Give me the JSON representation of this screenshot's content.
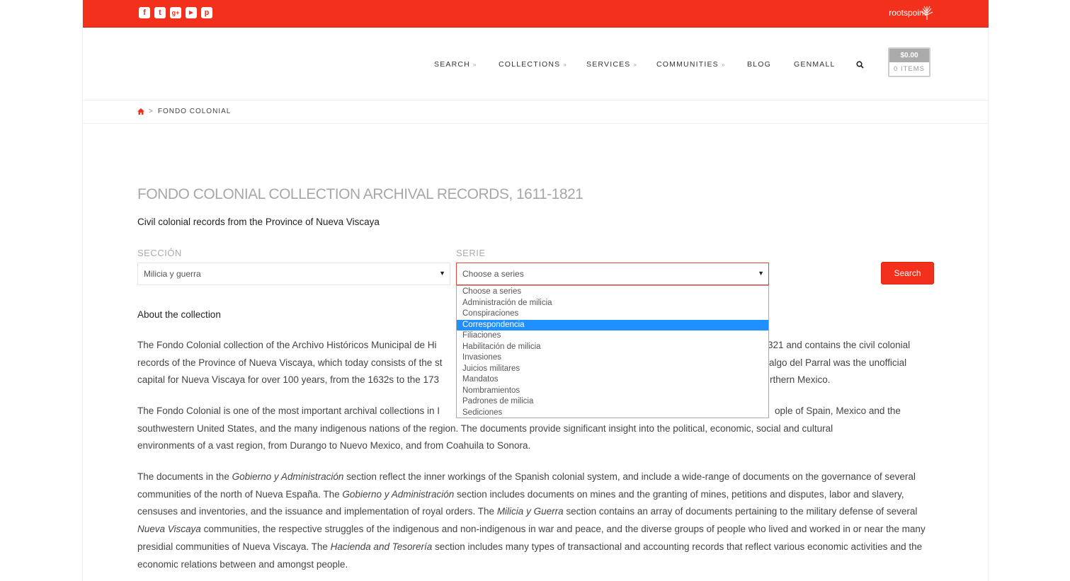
{
  "topbar": {
    "social_icons": [
      {
        "name": "facebook-icon",
        "glyph": "f"
      },
      {
        "name": "twitter-icon",
        "glyph": "t"
      },
      {
        "name": "google-plus-icon",
        "glyph": "g+"
      },
      {
        "name": "youtube-icon",
        "glyph": "▶"
      },
      {
        "name": "pinterest-icon",
        "glyph": "p"
      }
    ],
    "brand": "rootspoint",
    "color": "#f2301b"
  },
  "nav": {
    "items": [
      {
        "label": "SEARCH",
        "dropdown": true
      },
      {
        "label": "COLLECTIONS",
        "dropdown": true
      },
      {
        "label": "SERVICES",
        "dropdown": true
      },
      {
        "label": "COMMUNITIES",
        "dropdown": true
      },
      {
        "label": "BLOG",
        "dropdown": false
      },
      {
        "label": "GENMALL",
        "dropdown": false
      }
    ],
    "chevron": "»"
  },
  "cart": {
    "total": "$0.00",
    "items": "0 ITEMS"
  },
  "breadcrumb": {
    "current": "FONDO COLONIAL",
    "separator": ">"
  },
  "page": {
    "title": "FONDO COLONIAL COLLECTION ARCHIVAL RECORDS, 1611-1821",
    "subtitle": "Civil colonial records from the Province of Nueva Viscaya"
  },
  "form": {
    "seccion_label": "SECCIÓN",
    "seccion_value": "Milicia y guerra",
    "serie_label": "SERIE",
    "serie_value": "Choose a series",
    "search_label": "Search",
    "serie_options": [
      "Choose a series",
      "Administración de milicia",
      "Conspiraciones",
      "Correspondencia",
      "Filiaciones",
      "Habilitación de milicia",
      "Invasiones",
      "Juicios militares",
      "Mandatos",
      "Nombramientos",
      "Padrones de milicia",
      "Sediciones"
    ],
    "highlighted_option": "Correspondencia"
  },
  "about": {
    "heading": "About the collection",
    "p1_line1_left": "The Fondo Colonial collection of the Archivo Históricos Municipal de Hi",
    "p1_line1_right": "321 and contains the civil colonial",
    "p1_line2_left": "records of the Province of Nueva Viscaya, which today consists of the st",
    "p1_line2_right": "algo del Parral was the unofficial",
    "p1_line3_left": "capital for Nueva Viscaya for over 100 years, from the 1632s to the 173",
    "p1_line3_right": "rthern Mexico.",
    "p2_line1_left": "The Fondo Colonial is one of the most important archival collections in I",
    "p2_line1_right": "ople of Spain, Mexico and the",
    "p2_rest": "southwestern United States, and the many indigenous nations of the region. The documents provide significant insight into the political, economic, social and cultural environments of a vast region, from Durango to Nuevo Mexico, and from Coahuila to Sonora.",
    "p3": {
      "t1": "The documents in the ",
      "e1": "Gobierno y Administración",
      "t2": " section reflect the inner workings of the Spanish colonial system, and include a wide-range of documents on the governance of several communities of the north of Nueva España. The ",
      "e2": "Gobierno y Administración",
      "t3": " section includes documents on mines and the granting of mines, petitions and disputes, labor and slavery, censuses and inventories, and the issuance and implementation of royal orders. The ",
      "e3": "Milicia y Guerra",
      "t4": " section contains an array of documents pertaining to the military defense of several ",
      "e4": "Nueva Viscaya",
      "t5": " communities, the respective struggles of the indigenous and non-indigenous in war and peace, and the diverse groups of people who lived and worked in or near the many presidial communities of Nueva Viscaya. The ",
      "e5": "Hacienda and Tesorería",
      "t6": " section includes many types of transactional and accounting records that reflect various economic activities and the economic relations between and amongst people."
    }
  }
}
